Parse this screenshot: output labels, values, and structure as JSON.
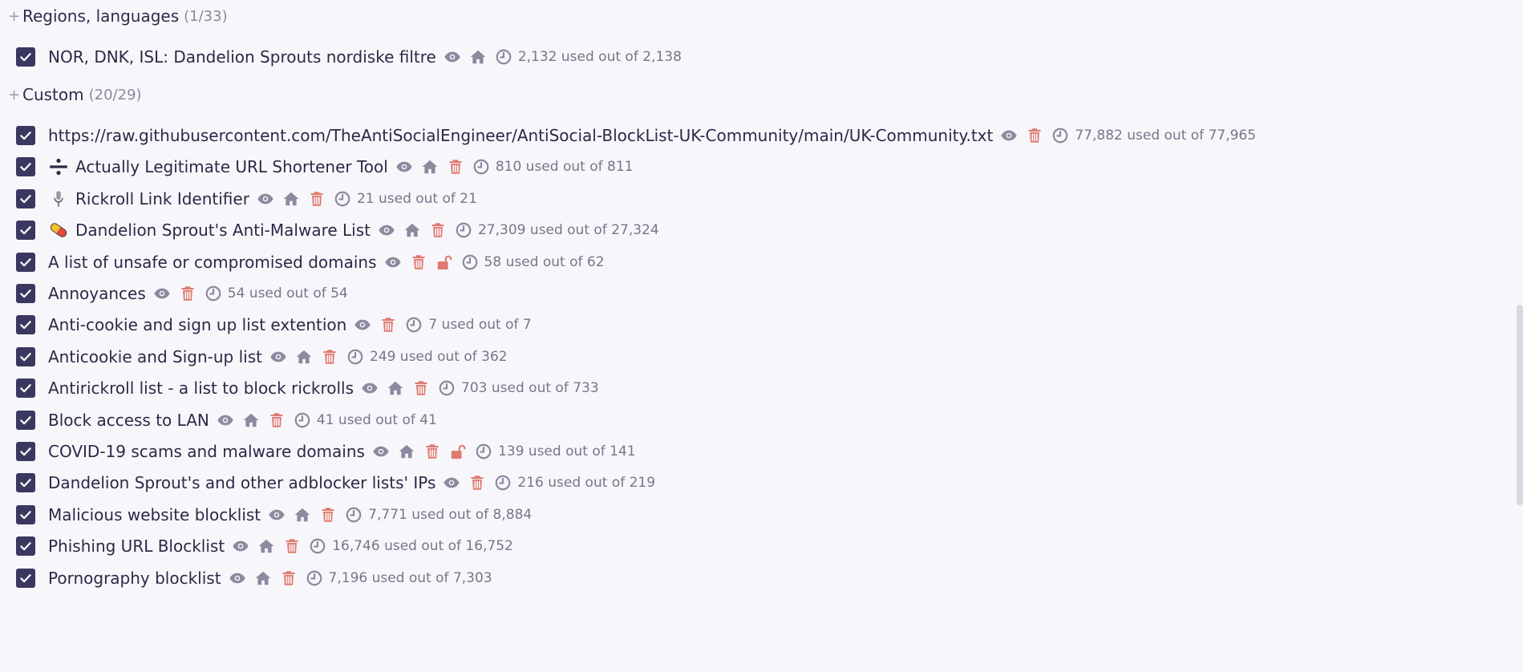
{
  "colors": {
    "checkbox": "#3a3760",
    "icon_gray": "#8b8a9e",
    "icon_red": "#e07a70",
    "text": "#2c2946",
    "muted": "#77758a"
  },
  "sections": [
    {
      "title": "Regions, languages",
      "count": "(1/33)",
      "items": [
        {
          "name": "NOR, DNK, ISL: Dandelion Sprouts nordiske filtre",
          "icons": [
            "eye-icon",
            "home-icon",
            "clock-icon"
          ],
          "usage": "2,132 used out of 2,138"
        }
      ]
    },
    {
      "title": "Custom",
      "count": "(20/29)",
      "items": [
        {
          "name": "https://raw.githubusercontent.com/TheAntiSocialEngineer/AntiSocial-BlockList-UK-Community/main/UK-Community.txt",
          "icons": [
            "eye-icon",
            "trash-icon",
            "clock-icon"
          ],
          "usage": "77,882 used out of 77,965"
        },
        {
          "emoji": "divide-icon",
          "name": "Actually Legitimate URL Shortener Tool",
          "icons": [
            "eye-icon",
            "home-icon",
            "trash-icon",
            "clock-icon"
          ],
          "usage": "810 used out of 811"
        },
        {
          "emoji": "microphone-icon",
          "name": "Rickroll Link Identifier",
          "icons": [
            "eye-icon",
            "home-icon",
            "trash-icon",
            "clock-icon"
          ],
          "usage": "21 used out of 21"
        },
        {
          "emoji": "pill-icon",
          "name": "Dandelion Sprout's Anti-Malware List",
          "icons": [
            "eye-icon",
            "home-icon",
            "trash-icon",
            "clock-icon"
          ],
          "usage": "27,309 used out of 27,324"
        },
        {
          "name": "A list of unsafe or compromised domains",
          "icons": [
            "eye-icon",
            "trash-icon",
            "unlock-icon",
            "clock-icon"
          ],
          "usage": "58 used out of 62"
        },
        {
          "name": "Annoyances",
          "icons": [
            "eye-icon",
            "trash-icon",
            "clock-icon"
          ],
          "usage": "54 used out of 54"
        },
        {
          "name": "Anti-cookie and sign up list extention",
          "icons": [
            "eye-icon",
            "trash-icon",
            "clock-icon"
          ],
          "usage": "7 used out of 7"
        },
        {
          "name": "Anticookie and Sign-up list",
          "icons": [
            "eye-icon",
            "home-icon",
            "trash-icon",
            "clock-icon"
          ],
          "usage": "249 used out of 362"
        },
        {
          "name": "Antirickroll list - a list to block rickrolls",
          "icons": [
            "eye-icon",
            "home-icon",
            "trash-icon",
            "clock-icon"
          ],
          "usage": "703 used out of 733"
        },
        {
          "name": "Block access to LAN",
          "icons": [
            "eye-icon",
            "home-icon",
            "trash-icon",
            "clock-icon"
          ],
          "usage": "41 used out of 41"
        },
        {
          "name": "COVID-19 scams and malware domains",
          "icons": [
            "eye-icon",
            "home-icon",
            "trash-icon",
            "unlock-icon",
            "clock-icon"
          ],
          "usage": "139 used out of 141"
        },
        {
          "name": "Dandelion Sprout's and other adblocker lists' IPs",
          "icons": [
            "eye-icon",
            "trash-icon",
            "clock-icon"
          ],
          "usage": "216 used out of 219"
        },
        {
          "name": "Malicious website blocklist",
          "icons": [
            "eye-icon",
            "home-icon",
            "trash-icon",
            "clock-icon"
          ],
          "usage": "7,771 used out of 8,884"
        },
        {
          "name": "Phishing URL Blocklist",
          "icons": [
            "eye-icon",
            "home-icon",
            "trash-icon",
            "clock-icon"
          ],
          "usage": "16,746 used out of 16,752"
        },
        {
          "name": "Pornography blocklist",
          "icons": [
            "eye-icon",
            "home-icon",
            "trash-icon",
            "clock-icon"
          ],
          "usage": "7,196 used out of 7,303"
        }
      ]
    }
  ]
}
